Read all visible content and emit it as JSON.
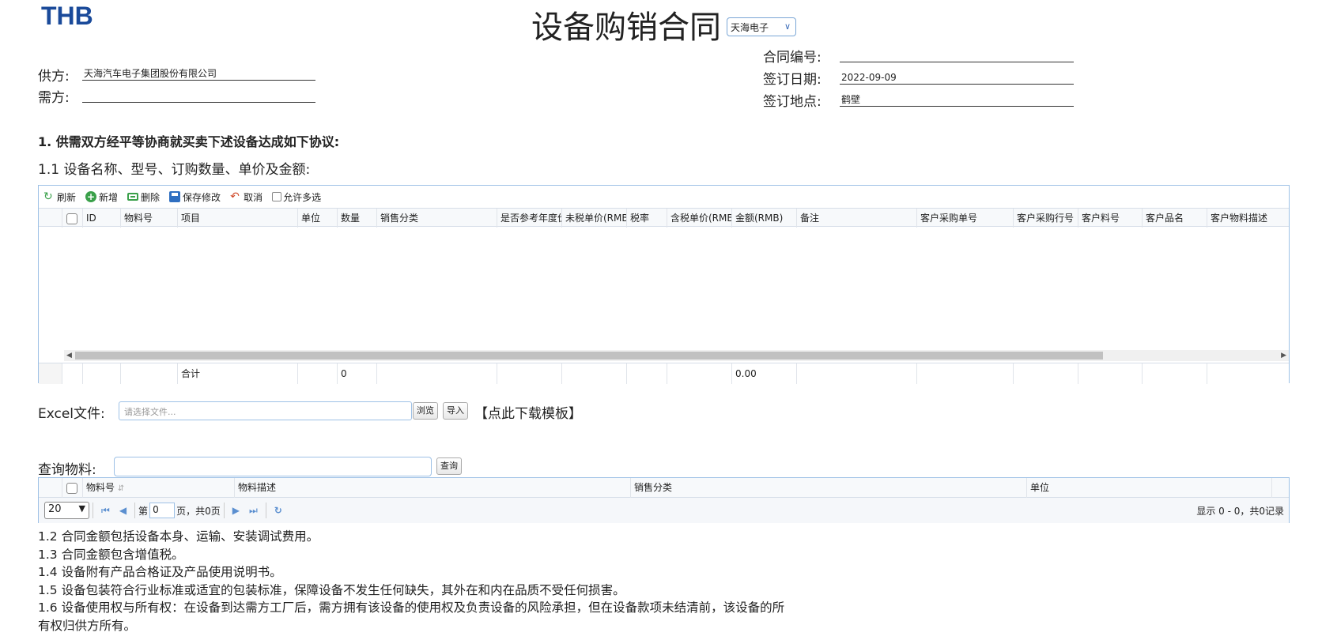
{
  "header": {
    "logo": "THB",
    "title": "设备购销合同",
    "company_select": "天海电子"
  },
  "parties": {
    "supplier_label": "供方:",
    "supplier_value": "天海汽车电子集团股份有限公司",
    "buyer_label": "需方:",
    "buyer_value": ""
  },
  "contract_info": {
    "number_label": "合同编号:",
    "number_value": "",
    "date_label": "签订日期:",
    "date_value": "2022-09-09",
    "place_label": "签订地点:",
    "place_value": "鹤壁"
  },
  "section1": {
    "heading": "1. 供需双方经平等协商就买卖下述设备达成如下协议:",
    "sub_heading": "1.1 设备名称、型号、订购数量、单价及金额:"
  },
  "toolbar": {
    "refresh": "刷新",
    "add": "新增",
    "delete": "删除",
    "save": "保存修改",
    "cancel": "取消",
    "multi_select": "允许多选"
  },
  "main_grid": {
    "columns": [
      "ID",
      "物料号",
      "项目",
      "单位",
      "数量",
      "销售分类",
      "是否参考年度价",
      "未税单价(RMB)",
      "税率",
      "含税单价(RMB)",
      "金额(RMB)",
      "备注",
      "客户采购单号",
      "客户采购行号",
      "客户料号",
      "客户品名",
      "客户物料描述"
    ],
    "footer": {
      "total_label": "合计",
      "quantity_total": "0",
      "amount_total": "0.00"
    }
  },
  "excel": {
    "label": "Excel文件:",
    "placeholder": "请选择文件...",
    "browse": "浏览",
    "import": "导入",
    "download": "【点此下载模板】"
  },
  "query": {
    "label": "查询物料:",
    "button": "查询"
  },
  "material_grid": {
    "columns": [
      "物料号",
      "物料描述",
      "销售分类",
      "单位"
    ],
    "sort_icon": "sort-icon"
  },
  "pager": {
    "page_size": "20",
    "page_prefix": "第",
    "page_value": "0",
    "page_suffix": "页，共0页",
    "summary": "显示 0 - 0，共0记录"
  },
  "terms": [
    "1.2 合同金额包括设备本身、运输、安装调试费用。",
    "1.3 合同金额包含增值税。",
    "1.4 设备附有产品合格证及产品使用说明书。",
    "1.5 设备包装符合行业标准或适宜的包装标准，保障设备不发生任何缺失，其外在和内在品质不受任何损害。",
    "1.6 设备使用权与所有权：在设备到达需方工厂后，需方拥有该设备的使用权及负责设备的风险承担，但在设备款项未结清前，该设备的所",
    "有权归供方所有。"
  ],
  "colors": {
    "logo": "#1a4a9a",
    "border": "#9ec1e6",
    "accent": "#5b8fd0"
  }
}
